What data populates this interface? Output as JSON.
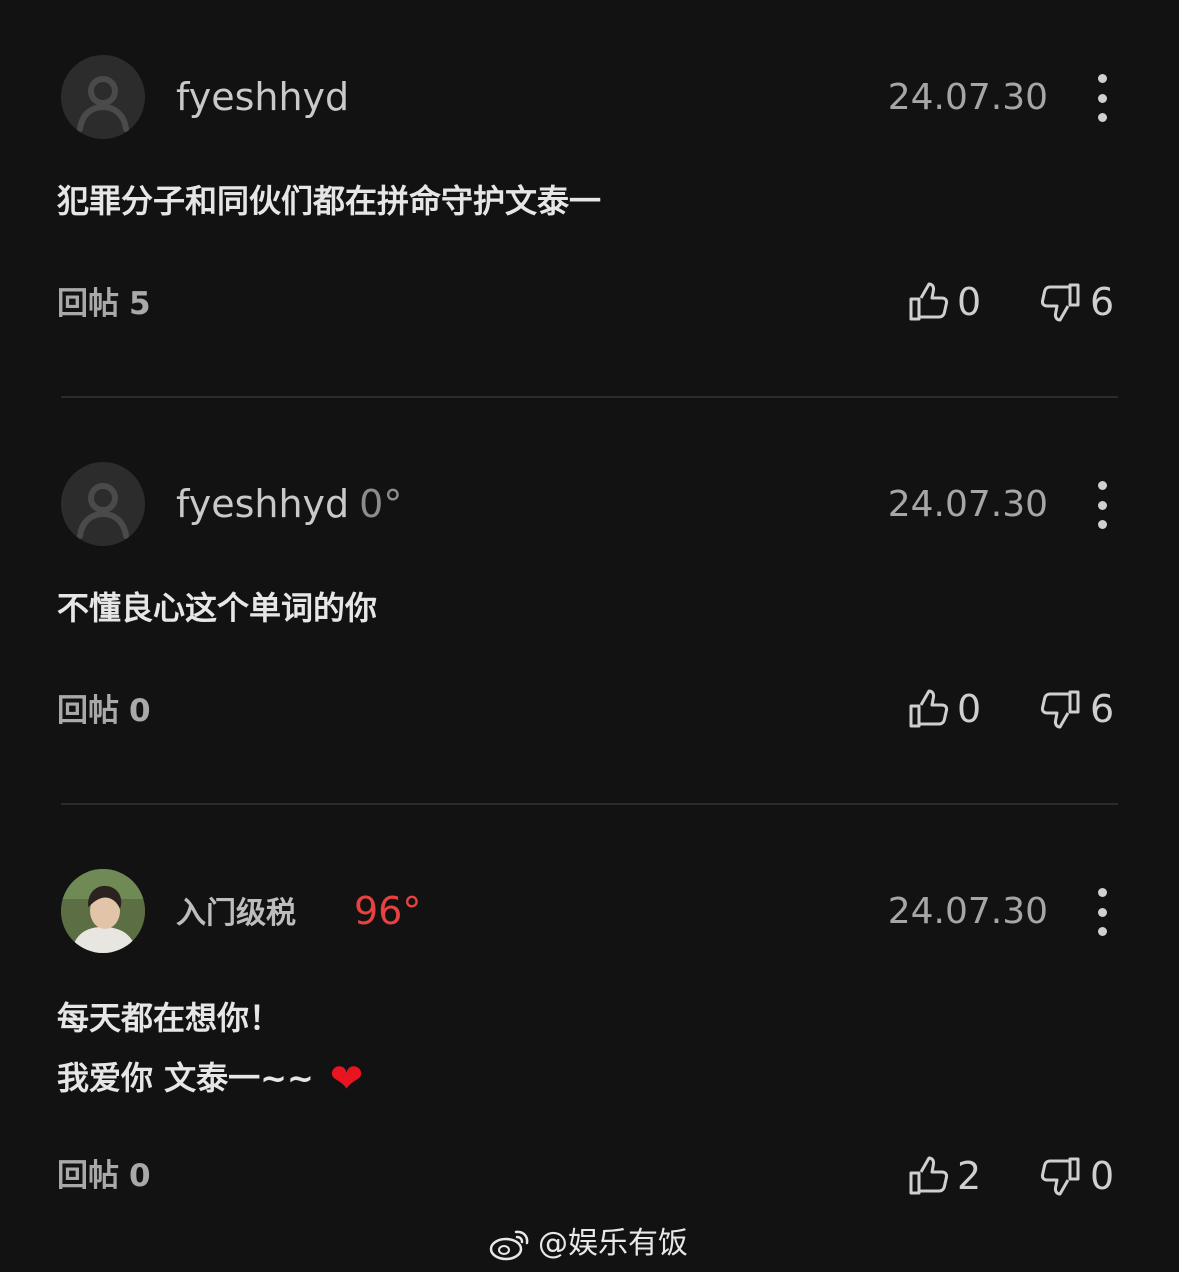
{
  "comments": [
    {
      "username": "fyeshhyd",
      "degree": "",
      "date": "24.07.30",
      "text_lines": [
        "犯罪分子和同伙们都在拼命守护文泰一"
      ],
      "reply_label": "回帖",
      "reply_count": "5",
      "likes": "0",
      "dislikes": "6"
    },
    {
      "username": "fyeshhyd",
      "degree": "0°",
      "date": "24.07.30",
      "text_lines": [
        "不懂良心这个单词的你"
      ],
      "reply_label": "回帖",
      "reply_count": "0",
      "likes": "0",
      "dislikes": "6"
    },
    {
      "username": "入门级税",
      "degree": "96°",
      "date": "24.07.30",
      "text_lines": [
        "每天都在想你！",
        "我爱你 文泰一~~"
      ],
      "heart": "❤",
      "reply_label": "回帖",
      "reply_count": "0",
      "likes": "2",
      "dislikes": "0"
    }
  ],
  "watermark": {
    "text": "@娱乐有饭",
    "icon": "weibo-logo"
  },
  "colors": {
    "background": "#121212",
    "hot_degree": "#e8413f",
    "heart": "#e8141f"
  }
}
